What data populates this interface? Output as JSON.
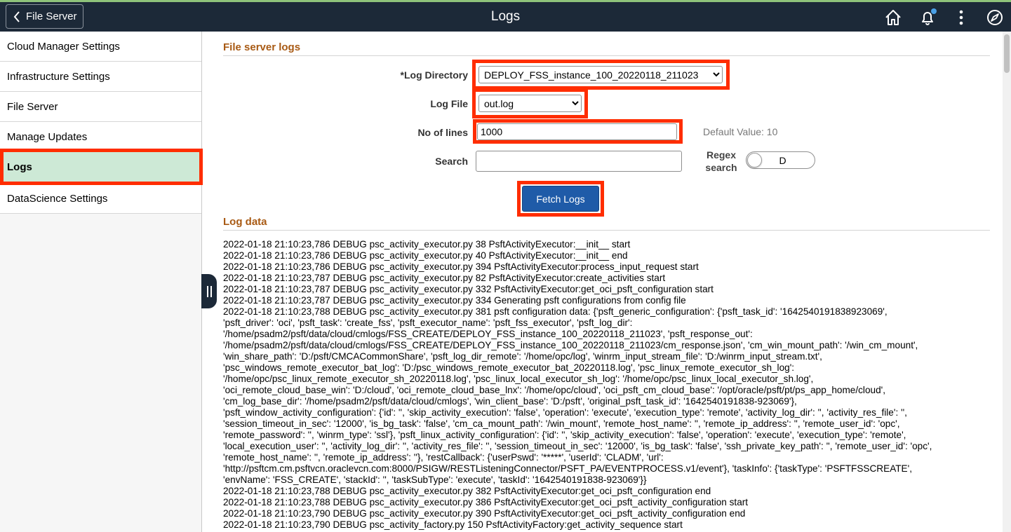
{
  "header": {
    "back_label": "File Server",
    "title": "Logs",
    "background": "#1c2938",
    "accent": "#8ec37a",
    "icons": [
      "home-icon",
      "bell-icon",
      "more-vertical-icon",
      "compass-icon"
    ]
  },
  "sidebar": {
    "items": [
      {
        "label": "Cloud Manager Settings"
      },
      {
        "label": "Infrastructure Settings"
      },
      {
        "label": "File Server"
      },
      {
        "label": "Manage Updates"
      },
      {
        "label": "Logs",
        "active": true
      },
      {
        "label": "DataScience Settings"
      }
    ],
    "active_color": "#cde9d6"
  },
  "form": {
    "section_title": "File server logs",
    "log_directory_label": "*Log Directory",
    "log_directory_value": "DEPLOY_FSS_instance_100_20220118_211023",
    "log_file_label": "Log File",
    "log_file_value": "out.log",
    "lines_label": "No of lines",
    "lines_value": "1000",
    "default_value_text": "Default Value: 10",
    "search_label": "Search",
    "search_value": "",
    "regex_label": "Regex search",
    "regex_toggle_text": "D",
    "fetch_label": "Fetch Logs",
    "highlight_color": "#ff2d00",
    "button_color": "#1f5ba8"
  },
  "log": {
    "section_title": "Log data",
    "lines": [
      "2022-01-18 21:10:23,786 DEBUG psc_activity_executor.py 38 PsftActivityExecutor:__init__ start",
      "2022-01-18 21:10:23,786 DEBUG psc_activity_executor.py 40 PsftActivityExecutor:__init__ end",
      "2022-01-18 21:10:23,786 DEBUG psc_activity_executor.py 394 PsftActivityExecutor:process_input_request start",
      "2022-01-18 21:10:23,787 DEBUG psc_activity_executor.py 82 PsftActivityExecutor:create_activities start",
      "2022-01-18 21:10:23,787 DEBUG psc_activity_executor.py 332 PsftActivityExecutor:get_oci_psft_configuration start",
      "2022-01-18 21:10:23,787 DEBUG psc_activity_executor.py 334 Generating psft configurations from config file",
      "2022-01-18 21:10:23,788 DEBUG psc_activity_executor.py 381 psft configuration data: {'psft_generic_configuration': {'psft_task_id': '1642540191838923069',",
      "'psft_driver': 'oci', 'psft_task': 'create_fss', 'psft_executor_name': 'psft_fss_executor', 'psft_log_dir':",
      "'/home/psadm2/psft/data/cloud/cmlogs/FSS_CREATE/DEPLOY_FSS_instance_100_20220118_211023', 'psft_response_out':",
      "'/home/psadm2/psft/data/cloud/cmlogs/FSS_CREATE/DEPLOY_FSS_instance_100_20220118_211023/cm_response.json', 'cm_win_mount_path': '/win_cm_mount',",
      "'win_share_path': 'D:/psft/CMCACommonShare', 'psft_log_dir_remote': '/home/opc/log', 'winrm_input_stream_file': 'D:/winrm_input_stream.txt',",
      "'psc_windows_remote_executor_bat_log': 'D:/psc_windows_remote_executor_bat_20220118.log', 'psc_linux_remote_executor_sh_log':",
      "'/home/opc/psc_linux_remote_executor_sh_20220118.log', 'psc_linux_local_executor_sh_log': '/home/opc/psc_linux_local_executor_sh.log',",
      "'oci_remote_cloud_base_win': 'D:/cloud', 'oci_remote_cloud_base_lnx': '/home/opc/cloud', 'oci_psft_cm_cloud_base': '/opt/oracle/psft/pt/ps_app_home/cloud',",
      "'cm_log_base_dir': '/home/psadm2/psft/data/cloud/cmlogs', 'win_client_base': 'D:/psft', 'original_psft_task_id': '1642540191838-923069'},",
      "'psft_window_activity_configuration': {'id': '', 'skip_activity_execution': 'false', 'operation': 'execute', 'execution_type': 'remote', 'activity_log_dir': '', 'activity_res_file': '',",
      "'session_timeout_in_sec': '12000', 'is_bg_task': 'false', 'cm_ca_mount_path': '/win_mount', 'remote_host_name': '', 'remote_ip_address': '', 'remote_user_id': 'opc',",
      "'remote_password': '', 'winrm_type': 'ssl'}, 'psft_linux_activity_configuration': {'id': '', 'skip_activity_execution': 'false', 'operation': 'execute', 'execution_type': 'remote',",
      "'local_execution_user': '', 'activity_log_dir': '', 'activity_res_file': '', 'session_timeout_in_sec': '12000', 'is_bg_task': 'false', 'ssh_private_key_path': '', 'remote_user_id': 'opc',",
      "'remote_host_name': '', 'remote_ip_address': ''}, 'restCallback': {'userPswd': '*****', 'userId': 'CLADM', 'url':",
      "'http://psftcm.cm.psftvcn.oraclevcn.com:8000/PSIGW/RESTListeningConnector/PSFT_PA/EVENTPROCESS.v1/event'}, 'taskInfo': {'taskType': 'PSFTFSSCREATE',",
      "'envName': 'FSS_CREATE', 'stackId': '', 'taskSubType': 'execute', 'taskId': '1642540191838-923069'}}",
      "2022-01-18 21:10:23,788 DEBUG psc_activity_executor.py 382 PsftActivityExecutor:get_oci_psft_configuration end",
      "2022-01-18 21:10:23,788 DEBUG psc_activity_executor.py 386 PsftActivityExecutor:get_oci_psft_activity_configuration start",
      "2022-01-18 21:10:23,790 DEBUG psc_activity_executor.py 390 PsftActivityExecutor:get_oci_psft_activity_configuration end",
      "2022-01-18 21:10:23,790 DEBUG psc_activity_factory.py 150 PsftActivityFactory:get_activity_sequence start"
    ]
  }
}
